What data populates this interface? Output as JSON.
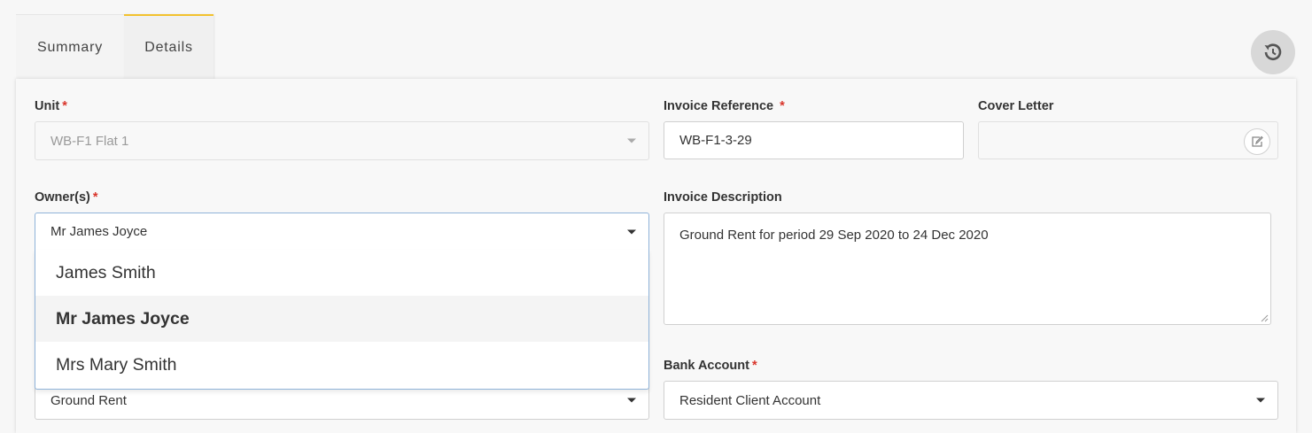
{
  "tabs": [
    {
      "label": "Summary",
      "active": false
    },
    {
      "label": "Details",
      "active": true
    }
  ],
  "history_icon": "history-icon",
  "form": {
    "unit": {
      "label": "Unit",
      "required": "*",
      "value": "WB-F1 Flat 1"
    },
    "invoice_reference": {
      "label": "Invoice Reference",
      "required": "*",
      "value": "WB-F1-3-29"
    },
    "cover_letter": {
      "label": "Cover Letter",
      "value": ""
    },
    "owners": {
      "label": "Owner(s)",
      "required": "*",
      "value": "Mr James Joyce",
      "options": [
        "James Smith",
        "Mr James Joyce",
        "Mrs Mary Smith"
      ],
      "selected": "Mr James Joyce"
    },
    "invoice_description": {
      "label": "Invoice Description",
      "value": "Ground Rent for period 29 Sep 2020 to 24 Dec 2020"
    },
    "charge_type": {
      "value": "Ground Rent"
    },
    "bank_account": {
      "label": "Bank Account",
      "required": "*",
      "value": "Resident Client Account"
    }
  },
  "colors": {
    "accent": "#f2c12e",
    "required": "#d9352b",
    "focus": "#8fb3d9"
  }
}
